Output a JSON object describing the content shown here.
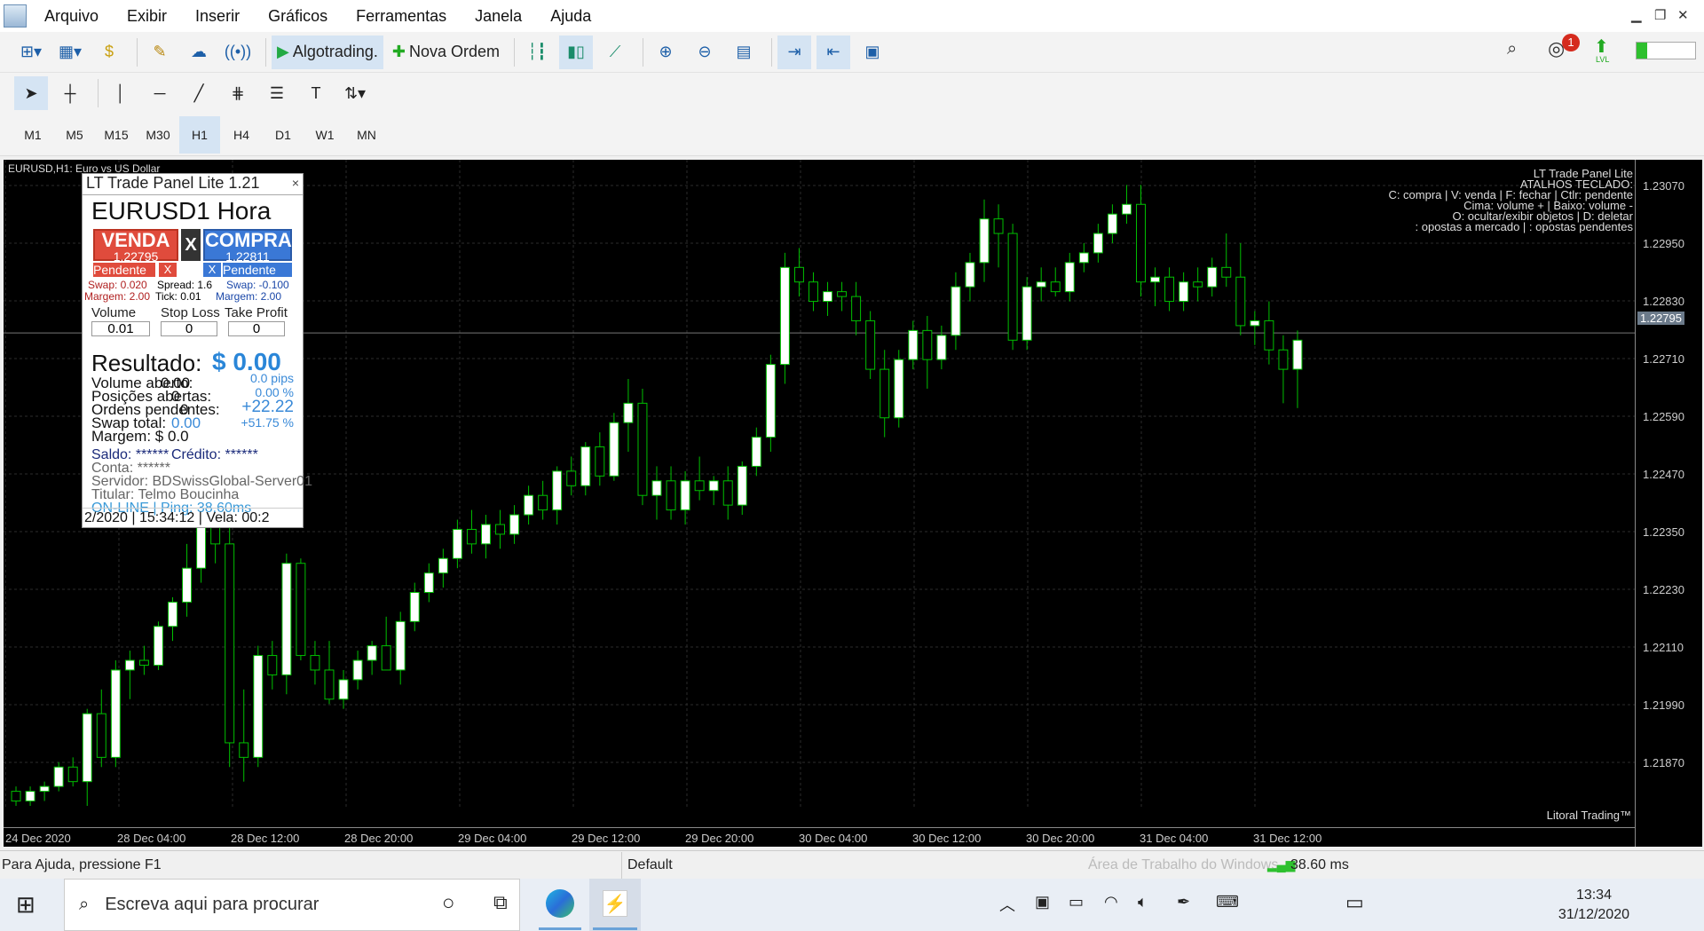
{
  "menu": {
    "items": [
      "Arquivo",
      "Exibir",
      "Inserir",
      "Gráficos",
      "Ferramentas",
      "Janela",
      "Ajuda"
    ]
  },
  "toolbar": {
    "algotrading_label": "Algotrading.",
    "new_order_label": "Nova Ordem",
    "notification_count": "1",
    "lvl_label": "LVL"
  },
  "timeframes": [
    "M1",
    "M5",
    "M15",
    "M30",
    "H1",
    "H4",
    "D1",
    "W1",
    "MN"
  ],
  "active_timeframe": "H1",
  "chart": {
    "title": "EURUSD,H1:  Euro vs US Dollar",
    "keyboard_info": [
      "LT Trade Panel Lite",
      "ATALHOS TECLADO:",
      "C: compra  |  V: venda  |  F: fechar  |  Ctlr: pendente",
      "Cima: volume +  |  Baixo: volume -",
      "O: ocultar/exibir objetos  |  D: deletar",
      ": opostas a mercado  |  : opostas pendentes"
    ],
    "brand": "Litoral Trading™",
    "price_labels": [
      "1.23070",
      "1.22950",
      "1.22830",
      "1.22710",
      "1.22590",
      "1.22470",
      "1.22350",
      "1.22230",
      "1.22110",
      "1.21990",
      "1.21870"
    ],
    "current_price": "1.22795",
    "time_labels": [
      "24 Dec 2020",
      "28 Dec 04:00",
      "28 Dec 12:00",
      "28 Dec 20:00",
      "29 Dec 04:00",
      "29 Dec 12:00",
      "29 Dec 20:00",
      "30 Dec 04:00",
      "30 Dec 12:00",
      "30 Dec 20:00",
      "31 Dec 04:00",
      "31 Dec 12:00"
    ]
  },
  "panel": {
    "title": "LT Trade Panel Lite 1.21",
    "close": "×",
    "symbol_title": "EURUSD1 Hora",
    "sell_label": "VENDA",
    "sell_price": "1.22795",
    "buy_label": "COMPRA",
    "buy_price": "1.22811",
    "x_label": "X",
    "pending_label": "Pendente",
    "pending_x": "X",
    "swap_sell": "Swap: 0.020",
    "spread": "Spread: 1.6",
    "swap_buy": "Swap: -0.100",
    "margin_sell": "Margem: 2.00",
    "tick": "Tick: 0.01",
    "margin_buy": "Margem: 2.00",
    "volume_label": "Volume",
    "sl_label": "Stop Loss",
    "tp_label": "Take Profit",
    "volume_value": "0.01",
    "sl_value": "0",
    "tp_value": "0",
    "result_label": "Resultado:",
    "result_value": "$ 0.00",
    "open_volume": "Volume aberto:",
    "open_volume_val": "0.00",
    "open_positions": "Posições abertas:",
    "open_positions_val": "0",
    "pending_orders": "Ordens pendentes:",
    "pending_orders_val": "0",
    "swap_total": "Swap total:",
    "swap_total_val": "0.00",
    "margin": "Margem: $ 0.0",
    "pips": "0.0 pips",
    "pct": "0.00 %",
    "plus_val": "+22.22",
    "plus_pct": "+51.75 %",
    "saldo": "Saldo: ******",
    "credito": "Crédito: ******",
    "conta": "Conta: ******",
    "servidor": "Servidor: BDSwissGlobal-Server01",
    "titular": "Titular: Telmo Boucinha",
    "online": "ON-LINE  |  Ping: 38.60ms",
    "footer": "2/2020  |  15:34:12  |  Vela: 00:2"
  },
  "status": {
    "help": "Para Ajuda, pressione F1",
    "profile": "Default",
    "activation": "Área de Trabalho do Windows",
    "ping": "38.60 ms"
  },
  "taskbar": {
    "search_placeholder": "Escreva aqui para procurar",
    "time": "13:34",
    "date": "31/12/2020"
  },
  "colors": {
    "bull": "#ffffff",
    "bear": "#000000",
    "wick": "#00c000",
    "grid": "#2c2c2c",
    "sell": "#e04b3c",
    "buy": "#3a78d6"
  },
  "chart_data": {
    "type": "candlestick",
    "price_range": [
      1.2182,
      1.2313
    ],
    "candles": [
      [
        1.2185,
        1.2186,
        1.2182,
        1.2183
      ],
      [
        1.2183,
        1.2186,
        1.2182,
        1.2185
      ],
      [
        1.2185,
        1.2187,
        1.2183,
        1.2186
      ],
      [
        1.2186,
        1.2191,
        1.2185,
        1.219
      ],
      [
        1.219,
        1.2192,
        1.2186,
        1.2187
      ],
      [
        1.2187,
        1.2202,
        1.2182,
        1.2201
      ],
      [
        1.2201,
        1.2206,
        1.219,
        1.2192
      ],
      [
        1.2192,
        1.2212,
        1.219,
        1.221
      ],
      [
        1.221,
        1.2214,
        1.2204,
        1.2212
      ],
      [
        1.2212,
        1.2215,
        1.2209,
        1.2211
      ],
      [
        1.2211,
        1.222,
        1.221,
        1.2219
      ],
      [
        1.2219,
        1.2225,
        1.2216,
        1.2224
      ],
      [
        1.2224,
        1.2236,
        1.2221,
        1.2231
      ],
      [
        1.2231,
        1.2245,
        1.2228,
        1.224
      ],
      [
        1.224,
        1.2244,
        1.2232,
        1.2236
      ],
      [
        1.2236,
        1.2241,
        1.219,
        1.2195
      ],
      [
        1.2195,
        1.2206,
        1.2187,
        1.2192
      ],
      [
        1.2192,
        1.2215,
        1.219,
        1.2213
      ],
      [
        1.2213,
        1.2216,
        1.2206,
        1.2209
      ],
      [
        1.2209,
        1.2234,
        1.2205,
        1.2232
      ],
      [
        1.2232,
        1.2233,
        1.2212,
        1.2213
      ],
      [
        1.2213,
        1.2216,
        1.2207,
        1.221
      ],
      [
        1.221,
        1.2216,
        1.2203,
        1.2204
      ],
      [
        1.2204,
        1.221,
        1.2202,
        1.2208
      ],
      [
        1.2208,
        1.2214,
        1.2206,
        1.2212
      ],
      [
        1.2212,
        1.2216,
        1.2209,
        1.2215
      ],
      [
        1.2215,
        1.2221,
        1.2212,
        1.221
      ],
      [
        1.221,
        1.2222,
        1.2207,
        1.222
      ],
      [
        1.222,
        1.2228,
        1.2218,
        1.2226
      ],
      [
        1.2226,
        1.2232,
        1.2224,
        1.223
      ],
      [
        1.223,
        1.2235,
        1.2227,
        1.2233
      ],
      [
        1.2233,
        1.2241,
        1.2231,
        1.2239
      ],
      [
        1.2239,
        1.2243,
        1.2234,
        1.2236
      ],
      [
        1.2236,
        1.2242,
        1.2233,
        1.224
      ],
      [
        1.224,
        1.2243,
        1.2235,
        1.2238
      ],
      [
        1.2238,
        1.2244,
        1.2236,
        1.2242
      ],
      [
        1.2242,
        1.2248,
        1.224,
        1.2246
      ],
      [
        1.2246,
        1.2249,
        1.2241,
        1.2243
      ],
      [
        1.2243,
        1.2252,
        1.224,
        1.2251
      ],
      [
        1.2251,
        1.2254,
        1.2246,
        1.2248
      ],
      [
        1.2248,
        1.2257,
        1.2246,
        1.2256
      ],
      [
        1.2256,
        1.2259,
        1.2248,
        1.225
      ],
      [
        1.225,
        1.2263,
        1.2249,
        1.2261
      ],
      [
        1.2261,
        1.227,
        1.2255,
        1.2265
      ],
      [
        1.2265,
        1.2268,
        1.2244,
        1.2246
      ],
      [
        1.2246,
        1.2252,
        1.2241,
        1.2249
      ],
      [
        1.2249,
        1.2252,
        1.2241,
        1.2243
      ],
      [
        1.2243,
        1.2251,
        1.224,
        1.2249
      ],
      [
        1.2249,
        1.2254,
        1.2245,
        1.2247
      ],
      [
        1.2247,
        1.225,
        1.2244,
        1.2249
      ],
      [
        1.2249,
        1.2252,
        1.2241,
        1.2244
      ],
      [
        1.2244,
        1.2253,
        1.2242,
        1.2252
      ],
      [
        1.2252,
        1.226,
        1.225,
        1.2258
      ],
      [
        1.2258,
        1.2275,
        1.2255,
        1.2273
      ],
      [
        1.2273,
        1.2296,
        1.2269,
        1.2293
      ],
      [
        1.2293,
        1.2297,
        1.2287,
        1.229
      ],
      [
        1.229,
        1.2292,
        1.2284,
        1.2286
      ],
      [
        1.2286,
        1.229,
        1.2283,
        1.2288
      ],
      [
        1.2288,
        1.229,
        1.2284,
        1.2287
      ],
      [
        1.2287,
        1.229,
        1.2279,
        1.2282
      ],
      [
        1.2282,
        1.2284,
        1.227,
        1.2272
      ],
      [
        1.2272,
        1.2276,
        1.2258,
        1.2262
      ],
      [
        1.2262,
        1.2276,
        1.226,
        1.2274
      ],
      [
        1.2274,
        1.2282,
        1.2272,
        1.228
      ],
      [
        1.228,
        1.2283,
        1.2268,
        1.2274
      ],
      [
        1.2274,
        1.2281,
        1.2272,
        1.2279
      ],
      [
        1.2279,
        1.2292,
        1.2276,
        1.2289
      ],
      [
        1.2289,
        1.2296,
        1.2286,
        1.2294
      ],
      [
        1.2294,
        1.2307,
        1.229,
        1.2303
      ],
      [
        1.2303,
        1.2306,
        1.2293,
        1.23
      ],
      [
        1.23,
        1.2302,
        1.2276,
        1.2278
      ],
      [
        1.2278,
        1.2291,
        1.2276,
        1.2289
      ],
      [
        1.2289,
        1.2293,
        1.2286,
        1.229
      ],
      [
        1.229,
        1.2293,
        1.2287,
        1.2288
      ],
      [
        1.2288,
        1.2296,
        1.2286,
        1.2294
      ],
      [
        1.2294,
        1.2298,
        1.2292,
        1.2296
      ],
      [
        1.2296,
        1.2302,
        1.2294,
        1.23
      ],
      [
        1.23,
        1.2306,
        1.2298,
        1.2304
      ],
      [
        1.2304,
        1.231,
        1.2302,
        1.2306
      ],
      [
        1.2306,
        1.231,
        1.2287,
        1.229
      ],
      [
        1.229,
        1.2293,
        1.2285,
        1.2291
      ],
      [
        1.2291,
        1.2293,
        1.2284,
        1.2286
      ],
      [
        1.2286,
        1.2292,
        1.2284,
        1.229
      ],
      [
        1.229,
        1.2293,
        1.2286,
        1.2289
      ],
      [
        1.2289,
        1.2295,
        1.2287,
        1.2293
      ],
      [
        1.2293,
        1.23,
        1.2289,
        1.2291
      ],
      [
        1.2291,
        1.2298,
        1.2279,
        1.2281
      ],
      [
        1.2281,
        1.2284,
        1.2277,
        1.2282
      ],
      [
        1.2282,
        1.2286,
        1.2273,
        1.2276
      ],
      [
        1.2276,
        1.2279,
        1.2265,
        1.2272
      ],
      [
        1.2272,
        1.228,
        1.2264,
        1.2278
      ]
    ]
  }
}
